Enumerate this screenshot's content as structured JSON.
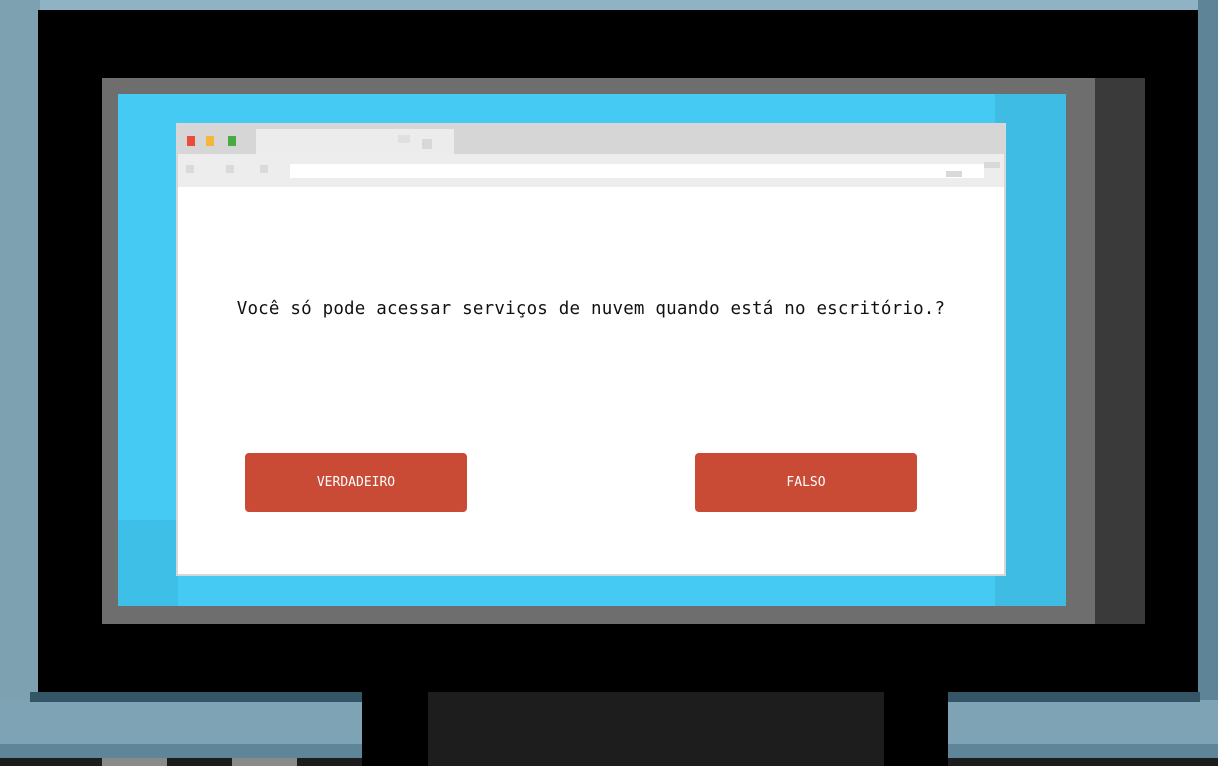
{
  "quiz": {
    "question": "Você só pode acessar serviços de nuvem quando está no escritório.?",
    "answers": {
      "true_label": "VERDADEIRO",
      "false_label": "FALSO"
    }
  },
  "colors": {
    "screen": "#45caf4",
    "button": "#c94a35",
    "window": "#ffffff",
    "bezel": "#000000"
  },
  "icons": [
    "window-close-icon",
    "window-minimize-icon",
    "window-maximize-icon"
  ]
}
